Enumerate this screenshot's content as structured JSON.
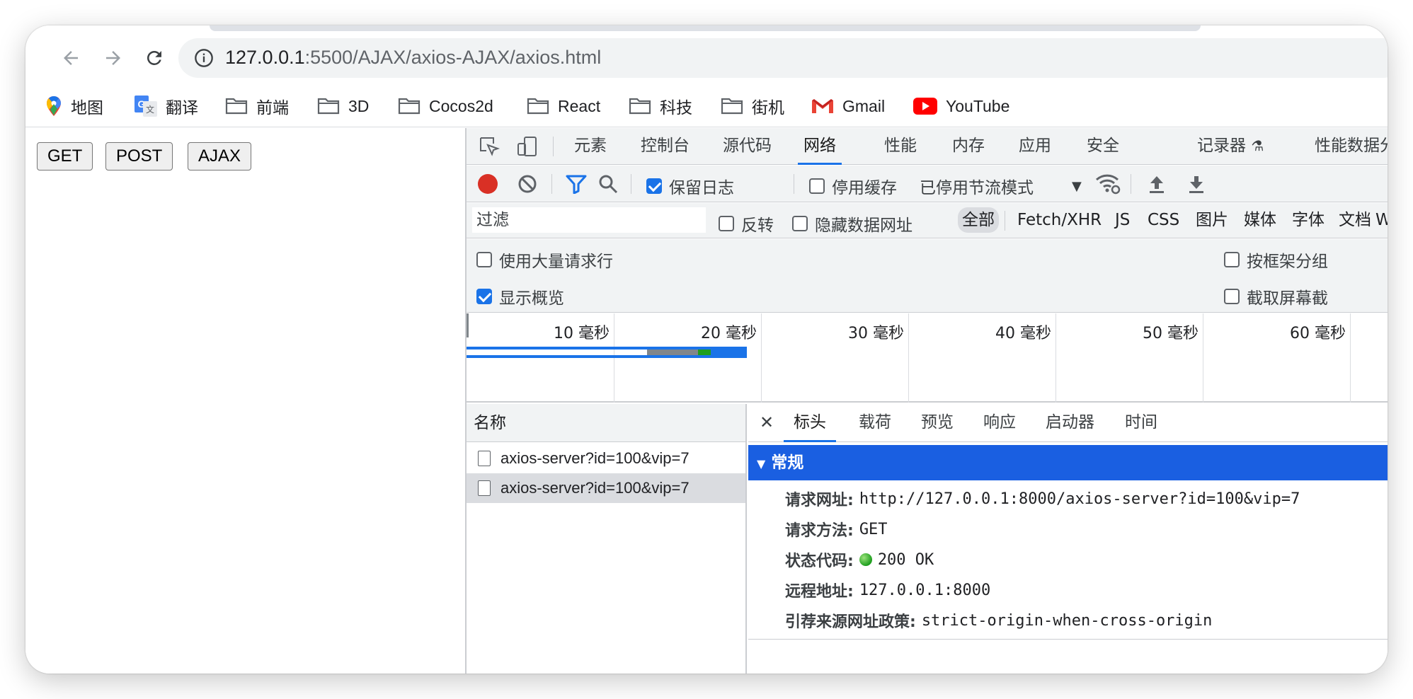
{
  "browser": {
    "url_host": "127.0.0.1",
    "url_rest": ":5500/AJAX/axios-AJAX/axios.html"
  },
  "bookmarks": [
    {
      "label": "地图",
      "icon": "maps-pin-icon"
    },
    {
      "label": "翻译",
      "icon": "translate-icon"
    },
    {
      "label": "前端",
      "icon": "folder-icon"
    },
    {
      "label": "3D",
      "icon": "folder-icon"
    },
    {
      "label": "Cocos2d",
      "icon": "folder-icon"
    },
    {
      "label": "React",
      "icon": "folder-icon"
    },
    {
      "label": "科技",
      "icon": "folder-icon"
    },
    {
      "label": "街机",
      "icon": "folder-icon"
    },
    {
      "label": "Gmail",
      "icon": "gmail-icon"
    },
    {
      "label": "YouTube",
      "icon": "youtube-icon"
    }
  ],
  "page": {
    "buttons": [
      "GET",
      "POST",
      "AJAX"
    ]
  },
  "devtools": {
    "tabs": [
      "元素",
      "控制台",
      "源代码",
      "网络",
      "性能",
      "内存",
      "应用",
      "安全",
      "记录器",
      "性能数据分析"
    ],
    "active_tab": "网络",
    "toolbar": {
      "preserve_log": "保留日志",
      "disable_cache": "停用缓存",
      "throttling": "已停用节流模式"
    },
    "filter": {
      "placeholder": "过滤",
      "invert": "反转",
      "hide_data_urls": "隐藏数据网址",
      "types": [
        "全部",
        "Fetch/XHR",
        "JS",
        "CSS",
        "图片",
        "媒体",
        "字体",
        "文档",
        "WS"
      ],
      "active_type": "全部"
    },
    "settings": {
      "big_request_rows": "使用大量请求行",
      "group_by_frame": "按框架分组",
      "show_overview": "显示概览",
      "capture_screenshots": "截取屏幕截"
    },
    "overview_ticks": [
      "10 毫秒",
      "20 毫秒",
      "30 毫秒",
      "40 毫秒",
      "50 毫秒",
      "60 毫秒"
    ],
    "requests": {
      "header": "名称",
      "rows": [
        "axios-server?id=100&vip=7",
        "axios-server?id=100&vip=7"
      ]
    },
    "detail": {
      "tabs": [
        "标头",
        "载荷",
        "预览",
        "响应",
        "启动器",
        "时间"
      ],
      "active_tab": "标头",
      "section": "常规",
      "fields": [
        {
          "key": "请求网址:",
          "value": "http://127.0.0.1:8000/axios-server?id=100&vip=7"
        },
        {
          "key": "请求方法:",
          "value": "GET"
        },
        {
          "key": "状态代码:",
          "value": "200 OK"
        },
        {
          "key": "远程地址:",
          "value": "127.0.0.1:8000"
        },
        {
          "key": "引荐来源网址政策:",
          "value": "strict-origin-when-cross-origin"
        }
      ]
    }
  },
  "colors": {
    "accent": "#1a73e8",
    "section_blue": "#1a5fe1",
    "record_red": "#d93025",
    "status_green": "#1e9e1e"
  }
}
